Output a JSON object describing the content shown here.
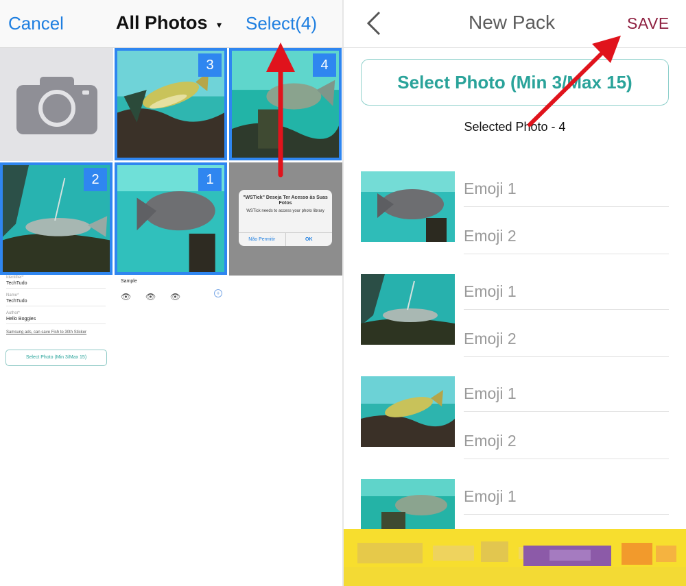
{
  "left": {
    "header": {
      "cancel": "Cancel",
      "title": "All Photos",
      "caret": "▾",
      "select": "Select(4)"
    },
    "grid": [
      {
        "type": "camera",
        "icon": "camera-icon"
      },
      {
        "type": "photo",
        "badge": "3",
        "selected": true
      },
      {
        "type": "photo",
        "badge": "4",
        "selected": true
      },
      {
        "type": "photo",
        "badge": "2",
        "selected": true
      },
      {
        "type": "photo",
        "badge": "1",
        "selected": true
      },
      {
        "type": "permission-dialog"
      }
    ],
    "dialog": {
      "title": "\"WSTick\" Deseja Ter Acesso às Suas Fotos",
      "message": "WSTick needs to access your photo library",
      "deny": "Não Permitir",
      "ok": "OK"
    },
    "form_ghost": {
      "identifier_label": "Identifier*",
      "identifier_value": "TechTudo",
      "name_label": "Name*",
      "name_value": "TechTudo",
      "author_label": "Author*",
      "author_value": "Hello Boggies",
      "link_text": "Samsung ads, can save Fish to 30th Sticker",
      "sample_label": "Sample",
      "sample_hint": "Sample",
      "button": "Select Photo (Min 3/Max 15)",
      "plus": "+"
    }
  },
  "right": {
    "header": {
      "title": "New Pack",
      "save": "SAVE"
    },
    "select_button": "Select Photo (Min 3/Max 15)",
    "selected_count": "Selected Photo - 4",
    "items": [
      {
        "emoji1": "Emoji 1",
        "emoji2": "Emoji 2"
      },
      {
        "emoji1": "Emoji 1",
        "emoji2": "Emoji 2"
      },
      {
        "emoji1": "Emoji 1",
        "emoji2": "Emoji 2"
      },
      {
        "emoji1": "Emoji 1"
      }
    ]
  },
  "colors": {
    "ios_blue": "#1f7fe0",
    "selection_blue": "#2f86f0",
    "teal": "#2aa39a",
    "save_maroon": "#8e2040",
    "arrow_red": "#e0131c",
    "ad_yellow": "#f7de2e"
  }
}
